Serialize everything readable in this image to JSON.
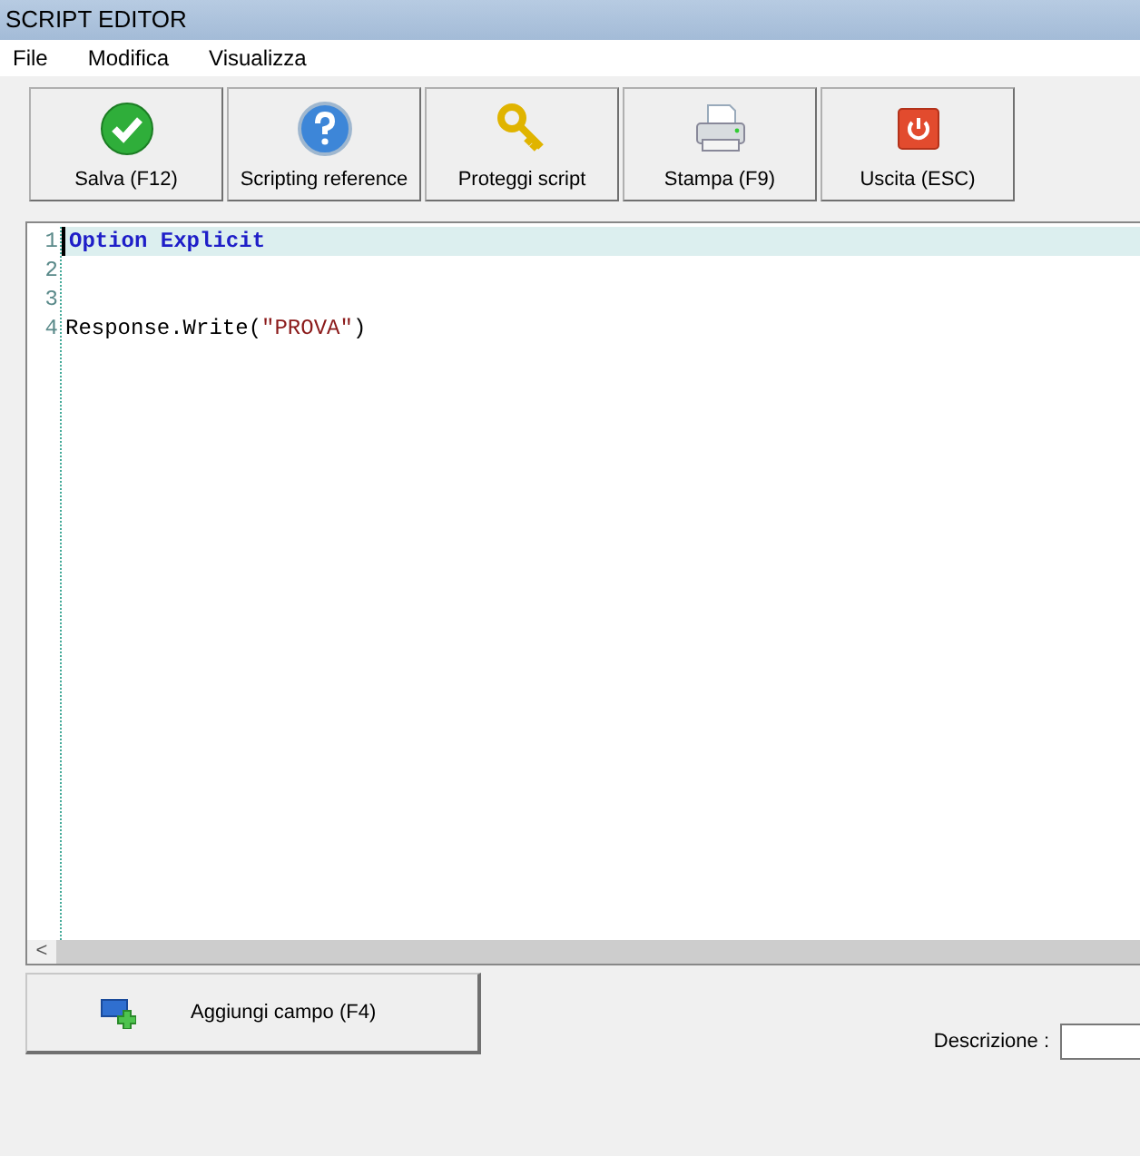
{
  "window": {
    "title": "SCRIPT EDITOR"
  },
  "menu": [
    "File",
    "Modifica",
    "Visualizza"
  ],
  "toolbar": [
    {
      "kind": "save",
      "label": "Salva (F12)"
    },
    {
      "kind": "help",
      "label": "Scripting reference"
    },
    {
      "kind": "key",
      "label": "Proteggi script"
    },
    {
      "kind": "print",
      "label": "Stampa (F9)"
    },
    {
      "kind": "exit",
      "label": "Uscita (ESC)"
    }
  ],
  "editor": {
    "lines": [
      {
        "number": "1",
        "current": true,
        "tokens": [
          {
            "kind": "keyword",
            "text": "Option Explicit"
          }
        ]
      },
      {
        "number": "2",
        "current": false
      },
      {
        "number": "3",
        "current": false
      },
      {
        "number": "4",
        "current": false,
        "tokens": [
          {
            "kind": "plain",
            "text": "Response.Write("
          },
          {
            "kind": "string",
            "text": "\"PROVA\""
          },
          {
            "kind": "plain",
            "text": ")"
          }
        ]
      }
    ],
    "scroll_left": "<"
  },
  "add_field_button": {
    "label": "Aggiungi campo (F4)"
  },
  "description": {
    "label": "Descrizione :"
  }
}
